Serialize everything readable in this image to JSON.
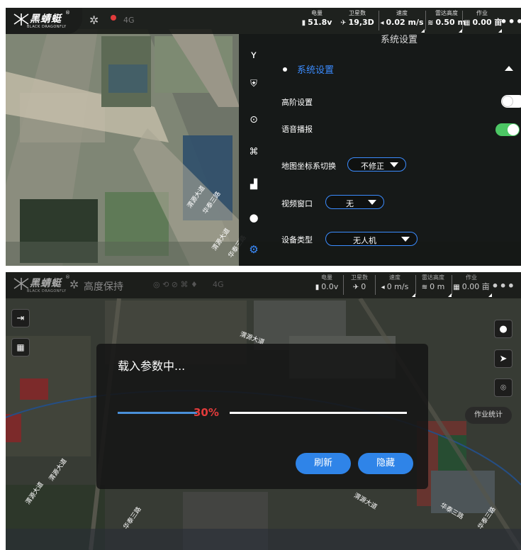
{
  "top_screen": {
    "brand": {
      "name": "黑蜻蜓",
      "registered": "®",
      "sub": "BLACK DRAGONFLY",
      "icon": "dragonfly-logo-icon"
    },
    "indicators": {
      "fan_icon": "fan-icon",
      "drone_icon": "drone-icon",
      "signal": "4G"
    },
    "telemetry": [
      {
        "label": "电量",
        "value": "51.8v",
        "icon": "battery-icon"
      },
      {
        "label": "卫星数",
        "value": "19,3D",
        "icon": "satellite-icon"
      },
      {
        "label": "速度",
        "value": "0.02 m/s",
        "icon": "speed-icon"
      },
      {
        "label": "雷达高度",
        "value": "0.50 m",
        "icon": "radar-icon"
      },
      {
        "label": "作业",
        "value": "0.00 亩",
        "icon": "work-area-icon"
      }
    ],
    "more_label": "•••",
    "map_labels": [
      "渭源大道",
      "华泰三路",
      "渭源大道",
      "华泰三路"
    ],
    "settings": {
      "title": "系统设置",
      "section_title": "系统设置",
      "rows": {
        "advanced": {
          "label": "高阶设置",
          "on": false
        },
        "voice": {
          "label": "语音播报",
          "on": true
        },
        "coord": {
          "label": "地图坐标系切换",
          "value": "不修正"
        },
        "video": {
          "label": "视频窗口",
          "value": "无"
        },
        "device": {
          "label": "设备类型",
          "value": "无人机"
        }
      },
      "side_icons": [
        "sprout-icon",
        "shield-icon",
        "target-icon",
        "drone-controller-icon",
        "field-icon",
        "user-icon",
        "gear-icon"
      ]
    },
    "colors": {
      "accent": "#3b8cff",
      "toggle_on": "#4cc764",
      "toggle_off": "#ffffff"
    }
  },
  "bottom_screen": {
    "brand": {
      "name": "黑蜻蜓",
      "registered": "®",
      "sub": "BLACK DRAGONFLY"
    },
    "mode": "高度保持",
    "signal": "4G",
    "telemetry": [
      {
        "label": "电量",
        "value": "0.0v",
        "icon": "battery-icon"
      },
      {
        "label": "卫星数",
        "value": "0",
        "icon": "satellite-icon"
      },
      {
        "label": "速度",
        "value": "0 m/s",
        "icon": "speed-icon"
      },
      {
        "label": "雷达高度",
        "value": "0 m",
        "icon": "radar-icon"
      },
      {
        "label": "作业",
        "value": "0.00 亩",
        "icon": "work-area-icon"
      }
    ],
    "more_label": "•••",
    "dialog": {
      "title": "载入参数中...",
      "progress_text": "30%",
      "progress": 0.3,
      "refresh_label": "刷新",
      "hide_label": "隐藏"
    },
    "stats_button": "作业统计",
    "left_buttons": [
      "exit-icon",
      "grid-icon"
    ],
    "right_buttons": [
      "user-icon",
      "navigate-icon",
      "location-icon"
    ],
    "map_labels": [
      "渭源大道",
      "渭源大道",
      "华泰三路",
      "华泰三路",
      "渭源大道",
      "渭源大道",
      "华泰三路"
    ],
    "colors": {
      "progress_done": "#4a90d9",
      "progress_text": "#e23b3b",
      "button": "#2f84e8"
    }
  }
}
